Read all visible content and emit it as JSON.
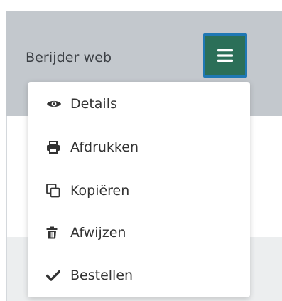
{
  "header": {
    "title": "Berijder web",
    "menu_button_icon": "hamburger-icon",
    "colors": {
      "header_bg": "#c3c8cd",
      "button_bg": "#2b6f58",
      "button_border": "#1f78b4"
    }
  },
  "dropdown": {
    "items": [
      {
        "label": "Details",
        "icon": "eye-icon"
      },
      {
        "label": "Afdrukken",
        "icon": "print-icon"
      },
      {
        "label": "Kopiëren",
        "icon": "copy-icon"
      },
      {
        "label": "Afwijzen",
        "icon": "trash-icon"
      },
      {
        "label": "Bestellen",
        "icon": "check-icon"
      }
    ]
  }
}
